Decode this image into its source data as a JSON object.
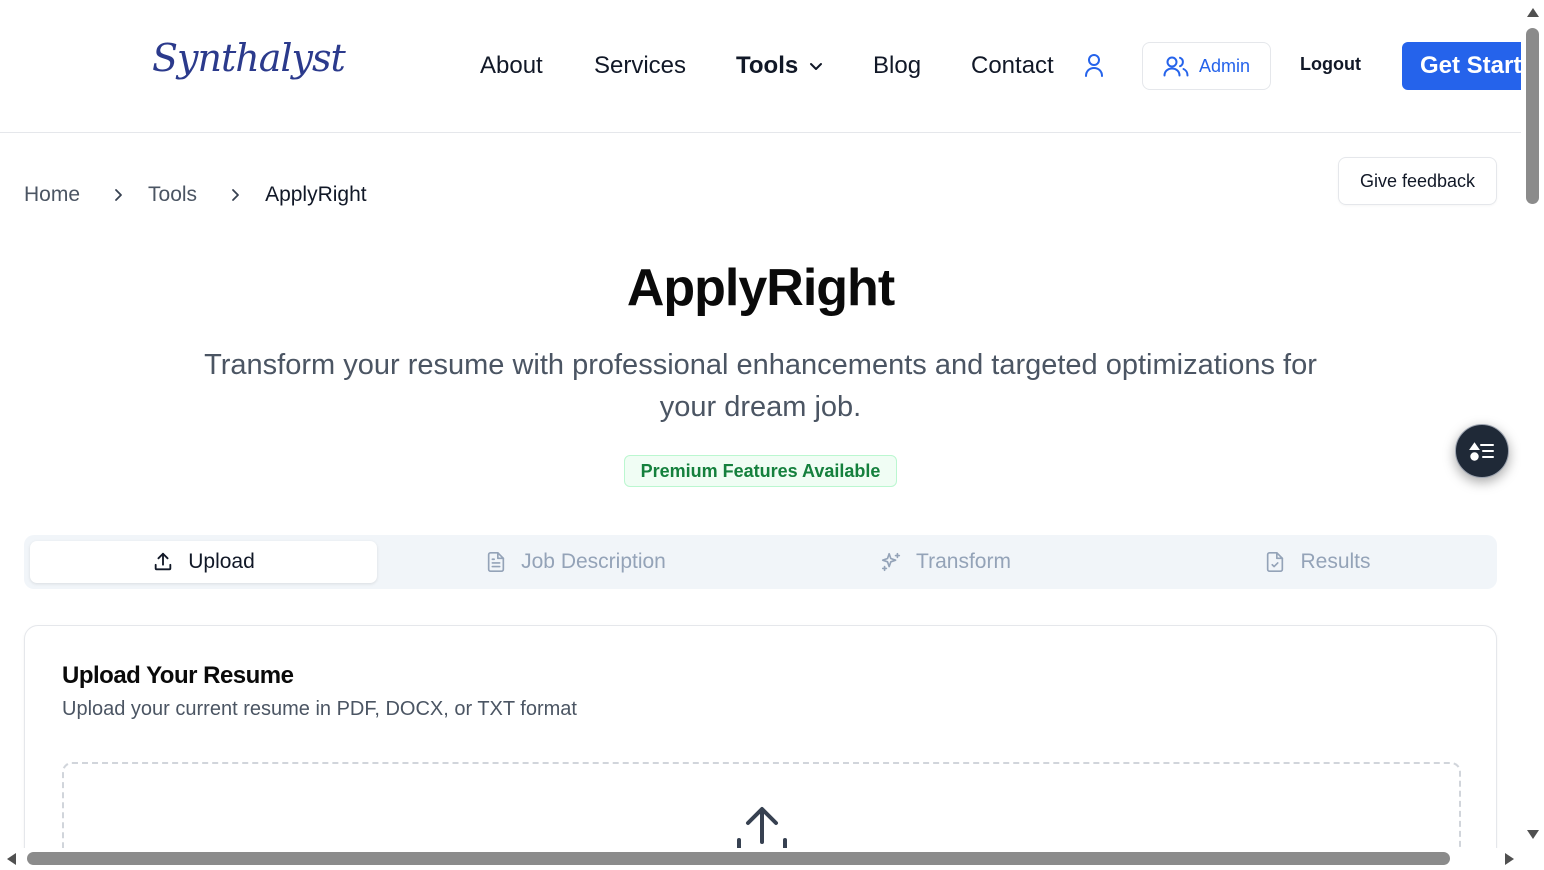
{
  "header": {
    "logo": "Synthalyst",
    "nav": {
      "about": "About",
      "services": "Services",
      "tools": "Tools",
      "blog": "Blog",
      "contact": "Contact"
    },
    "admin_label": "Admin",
    "logout_label": "Logout",
    "cta_label": "Get Started"
  },
  "breadcrumb": {
    "items": [
      "Home",
      "Tools",
      "ApplyRight"
    ]
  },
  "feedback_label": "Give feedback",
  "hero": {
    "title": "ApplyRight",
    "subtitle": "Transform your resume with professional enhancements and targeted optimizations for your dream job.",
    "badge": "Premium Features Available"
  },
  "tabs": [
    {
      "label": "Upload",
      "icon": "upload-icon",
      "active": true
    },
    {
      "label": "Job Description",
      "icon": "file-text-icon",
      "active": false
    },
    {
      "label": "Transform",
      "icon": "sparkles-icon",
      "active": false
    },
    {
      "label": "Results",
      "icon": "file-check-icon",
      "active": false
    }
  ],
  "upload_card": {
    "title": "Upload Your Resume",
    "subtitle": "Upload your current resume in PDF, DOCX, or TXT format"
  },
  "colors": {
    "primary": "#2563eb",
    "badge_text": "#15803d",
    "badge_bg": "#f0fdf4"
  }
}
